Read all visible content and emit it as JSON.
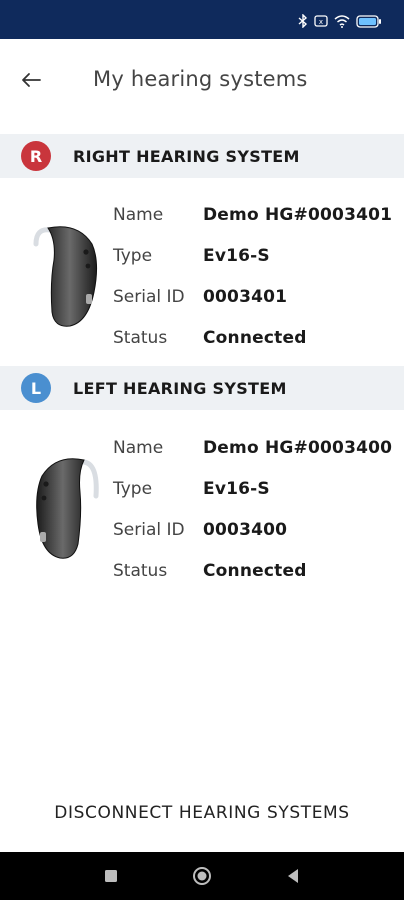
{
  "colors": {
    "status_bar": "#0f2a5c",
    "section_bg": "#eef1f4",
    "right_badge": "#c9353c",
    "left_badge": "#4a8fd0"
  },
  "status_bar": {
    "icons": [
      "bluetooth-icon",
      "nfc-icon",
      "wifi-icon",
      "battery-icon"
    ]
  },
  "header": {
    "back_icon": "arrow-left-icon",
    "title": "My hearing systems"
  },
  "right_system": {
    "badge": "R",
    "title": "RIGHT HEARING SYSTEM",
    "rows": [
      {
        "label": "Name",
        "value": "Demo HG#0003401"
      },
      {
        "label": "Type",
        "value": "Ev16-S"
      },
      {
        "label": "Serial ID",
        "value": "0003401"
      },
      {
        "label": "Status",
        "value": "Connected"
      }
    ]
  },
  "left_system": {
    "badge": "L",
    "title": "LEFT HEARING SYSTEM",
    "rows": [
      {
        "label": "Name",
        "value": "Demo HG#0003400"
      },
      {
        "label": "Type",
        "value": "Ev16-S"
      },
      {
        "label": "Serial ID",
        "value": "0003400"
      },
      {
        "label": "Status",
        "value": "Connected"
      }
    ]
  },
  "footer": {
    "disconnect_label": "DISCONNECT HEARING SYSTEMS"
  },
  "nav_bar": {
    "icons": [
      "recents-square-icon",
      "home-circle-icon",
      "back-triangle-icon"
    ]
  }
}
